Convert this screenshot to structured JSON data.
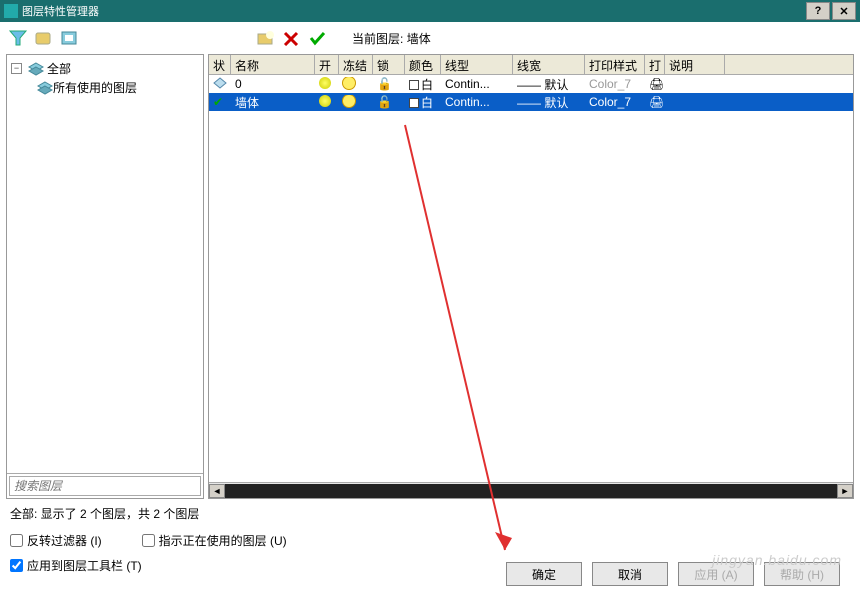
{
  "window": {
    "title": "图层特性管理器"
  },
  "toolbar": {
    "current_layer_label": "当前图层:",
    "current_layer_value": "墙体"
  },
  "tree": {
    "root": "全部",
    "child1": "所有使用的图层",
    "search_placeholder": "搜索图层"
  },
  "columns": {
    "status": "状",
    "name": "名称",
    "on": "开",
    "freeze": "冻结",
    "lock": "锁定",
    "color": "颜色",
    "linetype": "线型",
    "lineweight": "线宽",
    "plotstyle": "打印样式",
    "plot": "打",
    "description": "说明"
  },
  "rows": [
    {
      "status": "layer",
      "name": "0",
      "on": true,
      "freeze": false,
      "lock": false,
      "color": "白",
      "linetype": "Contin...",
      "lineweight": "—— 默认",
      "plotstyle": "Color_7",
      "plot": true,
      "selected": false,
      "current": false
    },
    {
      "status": "layer",
      "name": "墙体",
      "on": true,
      "freeze": false,
      "lock": false,
      "color": "白",
      "linetype": "Contin...",
      "lineweight": "—— 默认",
      "plotstyle": "Color_7",
      "plot": true,
      "selected": true,
      "current": true
    }
  ],
  "status": {
    "text": "全部: 显示了 2 个图层，共 2 个图层"
  },
  "options": {
    "invert_filter": "反转过滤器 (I)",
    "indicate_in_use": "指示正在使用的图层 (U)",
    "apply_toolbar": "应用到图层工具栏 (T)"
  },
  "buttons": {
    "ok": "确定",
    "cancel": "取消",
    "apply": "应用 (A)",
    "help": "帮助 (H)"
  },
  "watermark": "jingyan.baidu.com"
}
